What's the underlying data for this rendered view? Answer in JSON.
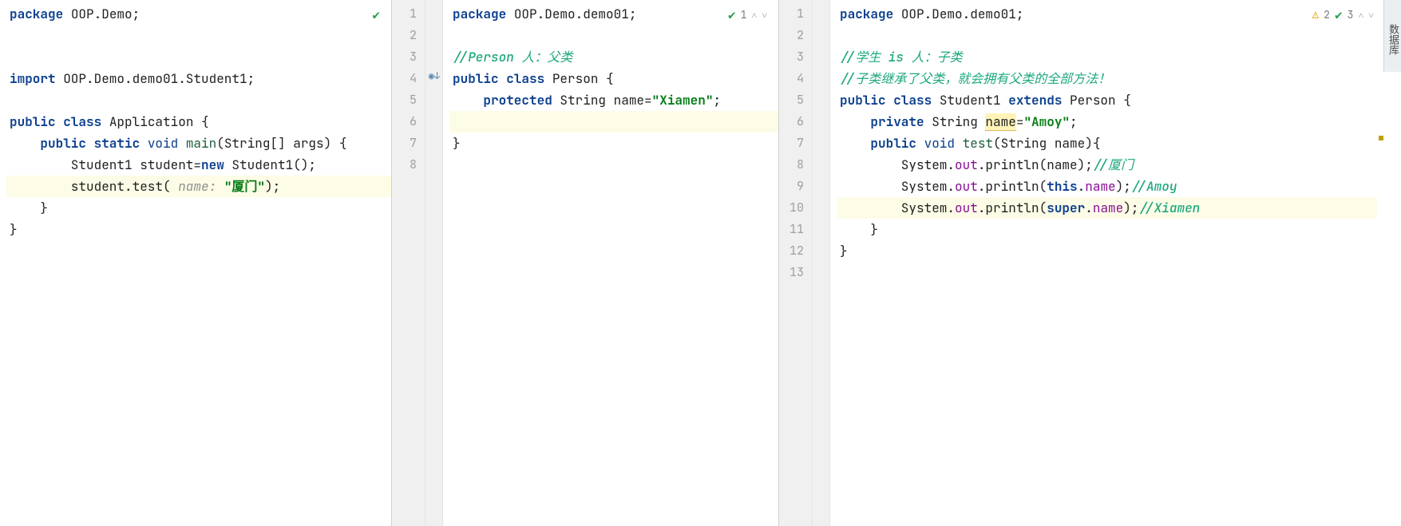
{
  "pane1": {
    "status": {
      "check": "✔"
    },
    "lines": [
      {
        "tokens": [
          {
            "t": "package ",
            "c": "kw"
          },
          {
            "t": "OOP.Demo;"
          }
        ]
      },
      {
        "tokens": []
      },
      {
        "tokens": []
      },
      {
        "tokens": [
          {
            "t": "import ",
            "c": "kw"
          },
          {
            "t": "OOP.Demo.demo01.Student1;"
          }
        ]
      },
      {
        "tokens": []
      },
      {
        "tokens": [
          {
            "t": "public class ",
            "c": "kw"
          },
          {
            "t": "Application {"
          }
        ]
      },
      {
        "tokens": [
          {
            "t": "    "
          },
          {
            "t": "public static ",
            "c": "kw"
          },
          {
            "t": "void ",
            "c": "type"
          },
          {
            "t": "main",
            "c": "mname"
          },
          {
            "t": "(String[] args) {"
          }
        ]
      },
      {
        "tokens": [
          {
            "t": "        Student1 student="
          },
          {
            "t": "new ",
            "c": "kw"
          },
          {
            "t": "Student1();"
          }
        ]
      },
      {
        "hl": true,
        "tokens": [
          {
            "t": "        student.test( "
          },
          {
            "t": "name: ",
            "c": "param-hint"
          },
          {
            "t": "\"厦门\"",
            "c": "str"
          },
          {
            "t": ");"
          }
        ]
      },
      {
        "tokens": [
          {
            "t": "    }"
          }
        ]
      },
      {
        "tokens": [
          {
            "t": "}"
          }
        ]
      }
    ]
  },
  "pane2": {
    "status": {
      "check": "✔",
      "count": "1"
    },
    "gutter_nums": [
      "1",
      "2",
      "3",
      "4",
      "5",
      "6",
      "7",
      "8"
    ],
    "icon_row": 4,
    "lines": [
      {
        "tokens": [
          {
            "t": "package ",
            "c": "kw"
          },
          {
            "t": "OOP.Demo.demo01;"
          }
        ]
      },
      {
        "tokens": []
      },
      {
        "tokens": [
          {
            "t": "//Person 人：父类",
            "c": "cmt-green"
          }
        ]
      },
      {
        "tokens": [
          {
            "t": "public class ",
            "c": "kw"
          },
          {
            "t": "Person {"
          }
        ]
      },
      {
        "tokens": [
          {
            "t": "    "
          },
          {
            "t": "protected ",
            "c": "kw"
          },
          {
            "t": "String name="
          },
          {
            "t": "\"Xiamen\"",
            "c": "str"
          },
          {
            "t": ";"
          }
        ]
      },
      {
        "hl": true,
        "tokens": [
          {
            "t": ""
          }
        ]
      },
      {
        "tokens": [
          {
            "t": "}"
          }
        ]
      },
      {
        "tokens": []
      }
    ]
  },
  "pane3": {
    "status": {
      "warn": "⚠",
      "warn_count": "2",
      "check": "✔",
      "check_count": "3"
    },
    "side_tab": "数据库",
    "gutter_nums": [
      "1",
      "2",
      "3",
      "4",
      "5",
      "6",
      "7",
      "8",
      "9",
      "10",
      "11",
      "12",
      "13"
    ],
    "lines": [
      {
        "tokens": [
          {
            "t": "package ",
            "c": "kw"
          },
          {
            "t": "OOP.Demo.demo01;"
          }
        ]
      },
      {
        "tokens": []
      },
      {
        "tokens": [
          {
            "t": "//学生 is 人：子类",
            "c": "cmt-green"
          }
        ]
      },
      {
        "tokens": [
          {
            "t": "//子类继承了父类，就会拥有父类的全部方法！",
            "c": "cmt-green"
          }
        ]
      },
      {
        "tokens": [
          {
            "t": "public class ",
            "c": "kw"
          },
          {
            "t": "Student1 "
          },
          {
            "t": "extends ",
            "c": "kw"
          },
          {
            "t": "Person {"
          }
        ]
      },
      {
        "tokens": [
          {
            "t": "    "
          },
          {
            "t": "private ",
            "c": "kw"
          },
          {
            "t": "String "
          },
          {
            "t": "name",
            "c": "name-bg warn-underline"
          },
          {
            "t": "="
          },
          {
            "t": "\"Amoy\"",
            "c": "str"
          },
          {
            "t": ";"
          }
        ]
      },
      {
        "tokens": [
          {
            "t": "    "
          },
          {
            "t": "public ",
            "c": "kw"
          },
          {
            "t": "void ",
            "c": "type"
          },
          {
            "t": "test",
            "c": "mname"
          },
          {
            "t": "(String name){"
          }
        ]
      },
      {
        "tokens": [
          {
            "t": "        System."
          },
          {
            "t": "out",
            "c": "field"
          },
          {
            "t": ".println(name);"
          },
          {
            "t": "//厦门",
            "c": "cmt-green"
          }
        ]
      },
      {
        "tokens": [
          {
            "t": "        System."
          },
          {
            "t": "out",
            "c": "field"
          },
          {
            "t": ".println("
          },
          {
            "t": "this",
            "c": "kw"
          },
          {
            "t": "."
          },
          {
            "t": "name",
            "c": "field"
          },
          {
            "t": ");"
          },
          {
            "t": "//Amoy",
            "c": "cmt-green"
          }
        ]
      },
      {
        "hl": true,
        "tokens": [
          {
            "t": "        System."
          },
          {
            "t": "out",
            "c": "field"
          },
          {
            "t": ".println("
          },
          {
            "t": "super",
            "c": "kw"
          },
          {
            "t": "."
          },
          {
            "t": "name",
            "c": "field"
          },
          {
            "t": ");"
          },
          {
            "t": "//Xiamen",
            "c": "cmt-green"
          }
        ]
      },
      {
        "tokens": [
          {
            "t": "    }"
          }
        ]
      },
      {
        "tokens": [
          {
            "t": "}"
          }
        ]
      },
      {
        "tokens": []
      }
    ]
  }
}
